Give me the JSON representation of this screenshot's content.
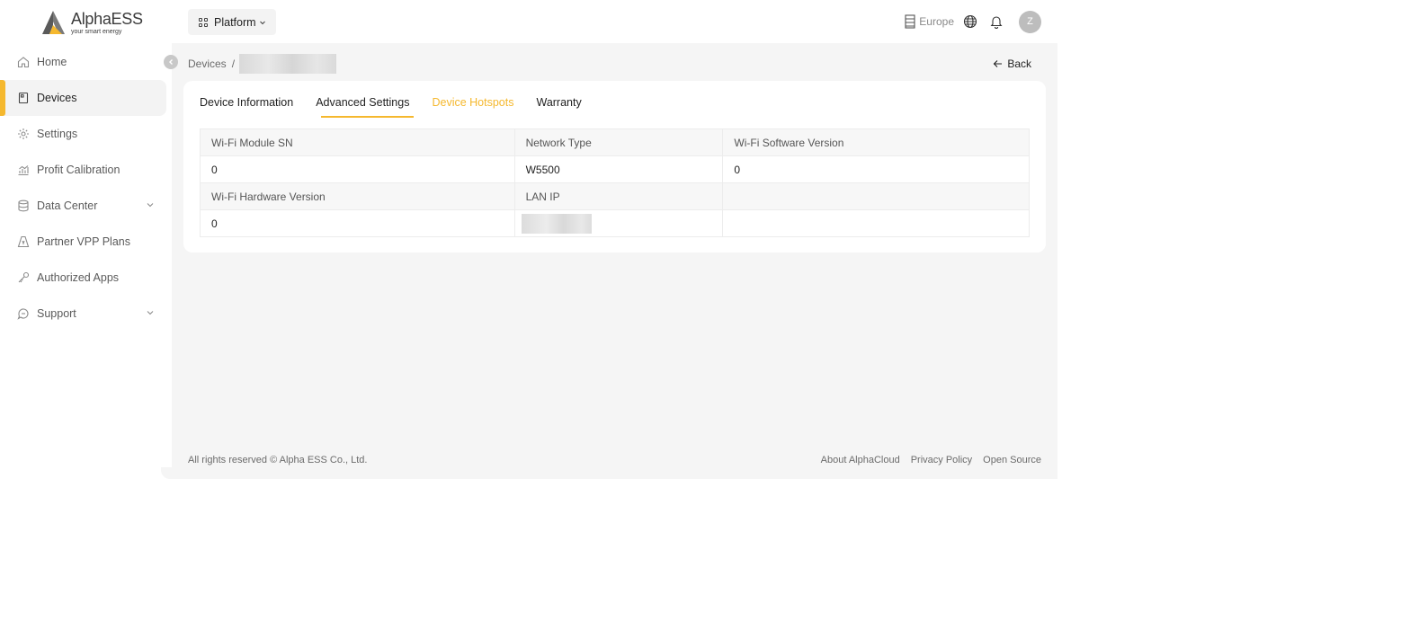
{
  "brand": {
    "name": "AlphaESS",
    "tagline": "your smart energy",
    "accent": "#f5b82e"
  },
  "sidebar": {
    "items": [
      {
        "label": "Home",
        "icon": "home-icon"
      },
      {
        "label": "Devices",
        "icon": "device-icon",
        "active": true
      },
      {
        "label": "Settings",
        "icon": "gear-icon"
      },
      {
        "label": "Profit Calibration",
        "icon": "chart-icon"
      },
      {
        "label": "Data Center",
        "icon": "database-icon",
        "expandable": true
      },
      {
        "label": "Partner VPP Plans",
        "icon": "plan-icon"
      },
      {
        "label": "Authorized Apps",
        "icon": "key-icon"
      },
      {
        "label": "Support",
        "icon": "support-icon",
        "expandable": true
      }
    ]
  },
  "topbar": {
    "platform_label": "Platform",
    "region_label": "Europe",
    "avatar_initial": "Z"
  },
  "breadcrumb": {
    "root": "Devices",
    "separator": "/"
  },
  "back_label": "Back",
  "tabs": [
    {
      "label": "Device Information"
    },
    {
      "label": "Advanced Settings",
      "active": true
    },
    {
      "label": "Device Hotspots",
      "highlighted": true
    },
    {
      "label": "Warranty"
    }
  ],
  "info_table": {
    "row1_labels": [
      "Wi-Fi Module SN",
      "Network Type",
      "Wi-Fi Software Version"
    ],
    "row1_values": [
      "0",
      "W5500",
      "0"
    ],
    "row2_labels": [
      "Wi-Fi Hardware Version",
      "LAN IP"
    ],
    "row2_values": [
      "0"
    ]
  },
  "footer": {
    "copyright": "All rights reserved © Alpha ESS Co., Ltd.",
    "links": [
      "About AlphaCloud",
      "Privacy Policy",
      "Open Source"
    ]
  }
}
